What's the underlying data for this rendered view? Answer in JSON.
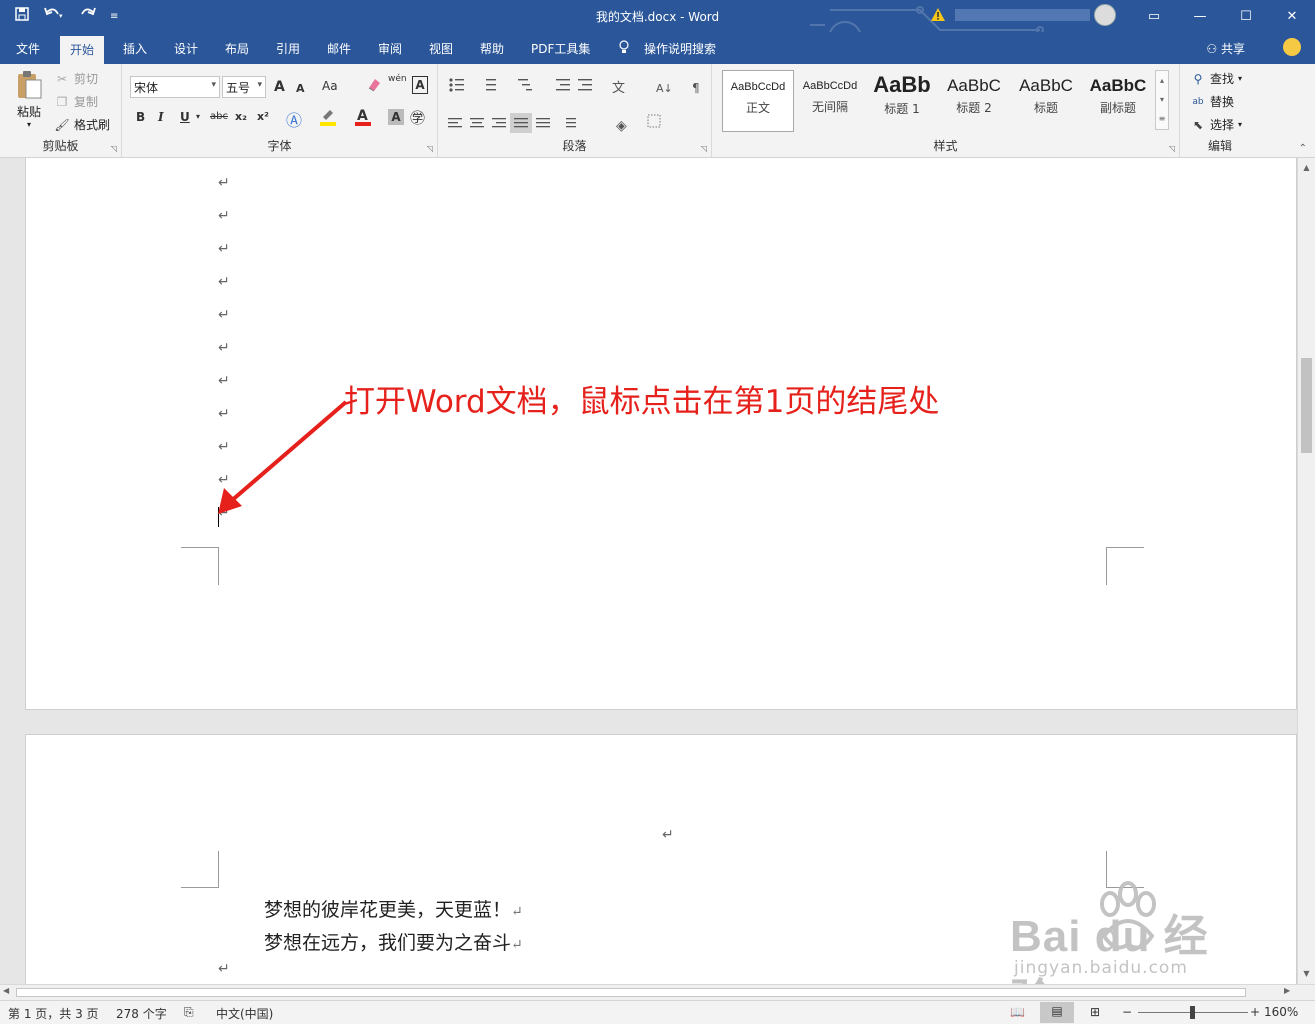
{
  "titlebar": {
    "title": "我的文档.docx  -  Word",
    "window_buttons": [
      "▭",
      "—",
      "☐",
      "✕"
    ]
  },
  "tabs": [
    {
      "label": "文件"
    },
    {
      "label": "开始"
    },
    {
      "label": "插入"
    },
    {
      "label": "设计"
    },
    {
      "label": "布局"
    },
    {
      "label": "引用"
    },
    {
      "label": "邮件"
    },
    {
      "label": "审阅"
    },
    {
      "label": "视图"
    },
    {
      "label": "帮助"
    },
    {
      "label": "PDF工具集"
    }
  ],
  "tell_me": "操作说明搜索",
  "share": "共享",
  "clipboard": {
    "paste": "粘贴",
    "cut": "剪切",
    "copy": "复制",
    "format_painter": "格式刷",
    "label": "剪贴板"
  },
  "font": {
    "name": "宋体",
    "size": "五号",
    "label": "字体",
    "change_case": "Aa",
    "bold": "B",
    "italic": "I",
    "underline": "U",
    "strike": "abc",
    "sub": "x₂",
    "sup": "x²",
    "grow": "A",
    "shrink": "A",
    "phonetic": "wén",
    "border": "A",
    "shade": "A"
  },
  "paragraph": {
    "label": "段落"
  },
  "styles": {
    "label": "样式",
    "items": [
      {
        "preview": "AaBbCcDd",
        "name": "正文"
      },
      {
        "preview": "AaBbCcDd",
        "name": "无间隔"
      },
      {
        "preview": "AaBb",
        "name": "标题 1"
      },
      {
        "preview": "AaBbC",
        "name": "标题 2"
      },
      {
        "preview": "AaBbC",
        "name": "标题"
      },
      {
        "preview": "AaBbC",
        "name": "副标题"
      }
    ]
  },
  "editing": {
    "label": "编辑",
    "find": "查找",
    "replace": "替换",
    "select": "选择"
  },
  "document": {
    "annotation": "打开Word文档，鼠标点击在第1页的结尾处",
    "para_mark": "↵",
    "line1": "梦想的彼岸花更美，天更蓝！",
    "line2": "梦想在远方，我们要为之奋斗"
  },
  "watermark": {
    "big": "Bai du 经验",
    "small": "jingyan.baidu.com"
  },
  "status": {
    "page": "第 1 页，共 3 页",
    "words": "278 个字",
    "language": "中文(中国)",
    "zoom": "160%",
    "zoom_minus": "−",
    "zoom_plus": "+"
  },
  "colors": {
    "accent": "#2b579a",
    "annotation": "#e6201a",
    "highlight": "#ffe600",
    "font_color": "#e6201a"
  }
}
